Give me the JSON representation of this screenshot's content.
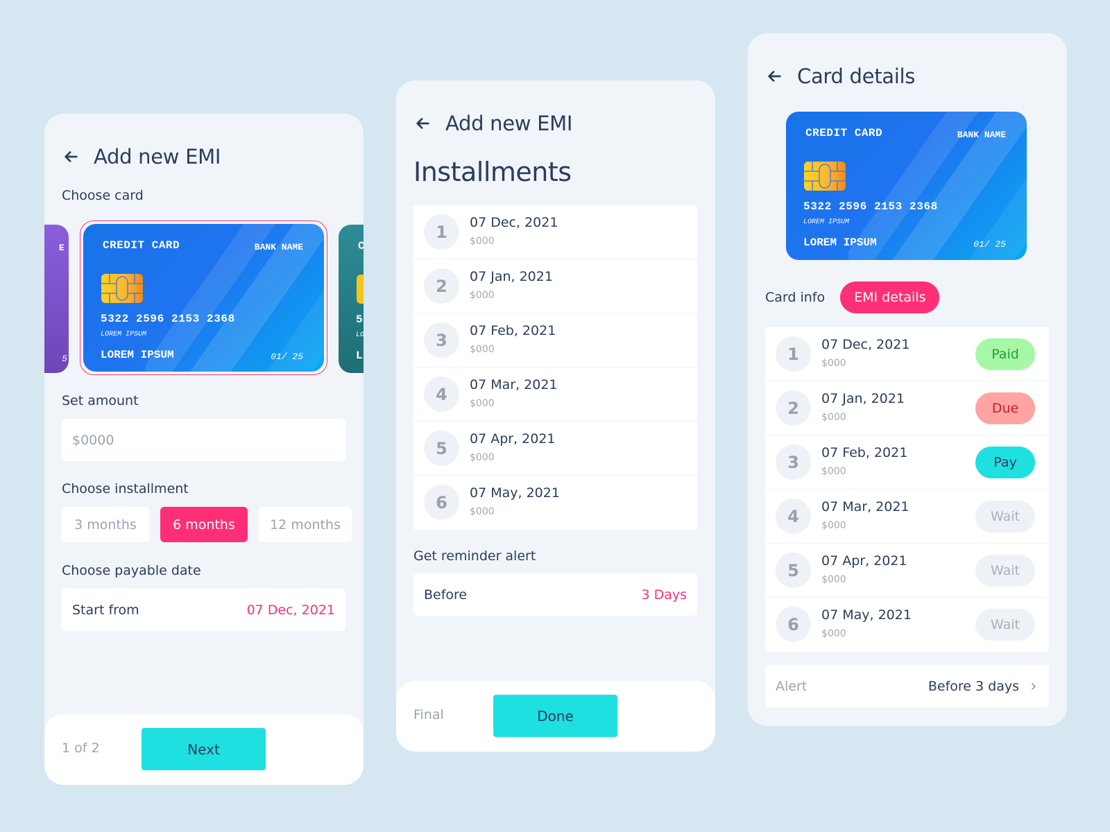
{
  "colors": {
    "accent_pink": "#ff2f77",
    "accent_cyan": "#1fe0e0",
    "background": "#d6e7f1",
    "panel": "#f1f5f9",
    "text_dark": "#2b3d5c",
    "text_muted": "#9aa3b2"
  },
  "card": {
    "type": "CREDIT CARD",
    "bank": "BANK NAME",
    "number": "5322 2596 2153 2368",
    "sub": "LOREM IPSUM",
    "holder": "LOREM IPSUM",
    "expiry": "01/ 25"
  },
  "screen1": {
    "title": "Add new EMI",
    "choose_card_label": "Choose card",
    "left_card_peek": {
      "top_char": "E",
      "bottom_char": "5"
    },
    "right_card_peek": {
      "top_char": "C",
      "num_char": "5",
      "sub_char": "LO",
      "holder_char": "L"
    },
    "set_amount_label": "Set amount",
    "amount_placeholder": "$0000",
    "choose_installment_label": "Choose installment",
    "installment_options": [
      "3 months",
      "6 months",
      "12 months"
    ],
    "selected_installment": "6 months",
    "payable_date_label": "Choose payable date",
    "start_from_label": "Start from",
    "start_from_value": "07 Dec, 2021",
    "footer": {
      "step": "1 of 2",
      "button": "Next"
    }
  },
  "screen2": {
    "title": "Add new EMI",
    "heading": "Installments",
    "installments": [
      {
        "n": "1",
        "date": "07 Dec, 2021",
        "amount": "$000"
      },
      {
        "n": "2",
        "date": "07 Jan, 2021",
        "amount": "$000"
      },
      {
        "n": "3",
        "date": "07 Feb, 2021",
        "amount": "$000"
      },
      {
        "n": "4",
        "date": "07 Mar, 2021",
        "amount": "$000"
      },
      {
        "n": "5",
        "date": "07 Apr, 2021",
        "amount": "$000"
      },
      {
        "n": "6",
        "date": "07 May, 2021",
        "amount": "$000"
      }
    ],
    "reminder_label": "Get reminder alert",
    "before_label": "Before",
    "before_value": "3 Days",
    "footer": {
      "step": "Final",
      "button": "Done"
    }
  },
  "screen3": {
    "title": "Card details",
    "tabs": [
      "Card info",
      "EMI details"
    ],
    "active_tab": "EMI details",
    "installments": [
      {
        "n": "1",
        "date": "07 Dec, 2021",
        "amount": "$000",
        "status": "Paid"
      },
      {
        "n": "2",
        "date": "07 Jan, 2021",
        "amount": "$000",
        "status": "Due"
      },
      {
        "n": "3",
        "date": "07 Feb, 2021",
        "amount": "$000",
        "status": "Pay"
      },
      {
        "n": "4",
        "date": "07 Mar, 2021",
        "amount": "$000",
        "status": "Wait"
      },
      {
        "n": "5",
        "date": "07 Apr, 2021",
        "amount": "$000",
        "status": "Wait"
      },
      {
        "n": "6",
        "date": "07 May, 2021",
        "amount": "$000",
        "status": "Wait"
      }
    ],
    "alert_label": "Alert",
    "alert_value": "Before 3 days"
  }
}
